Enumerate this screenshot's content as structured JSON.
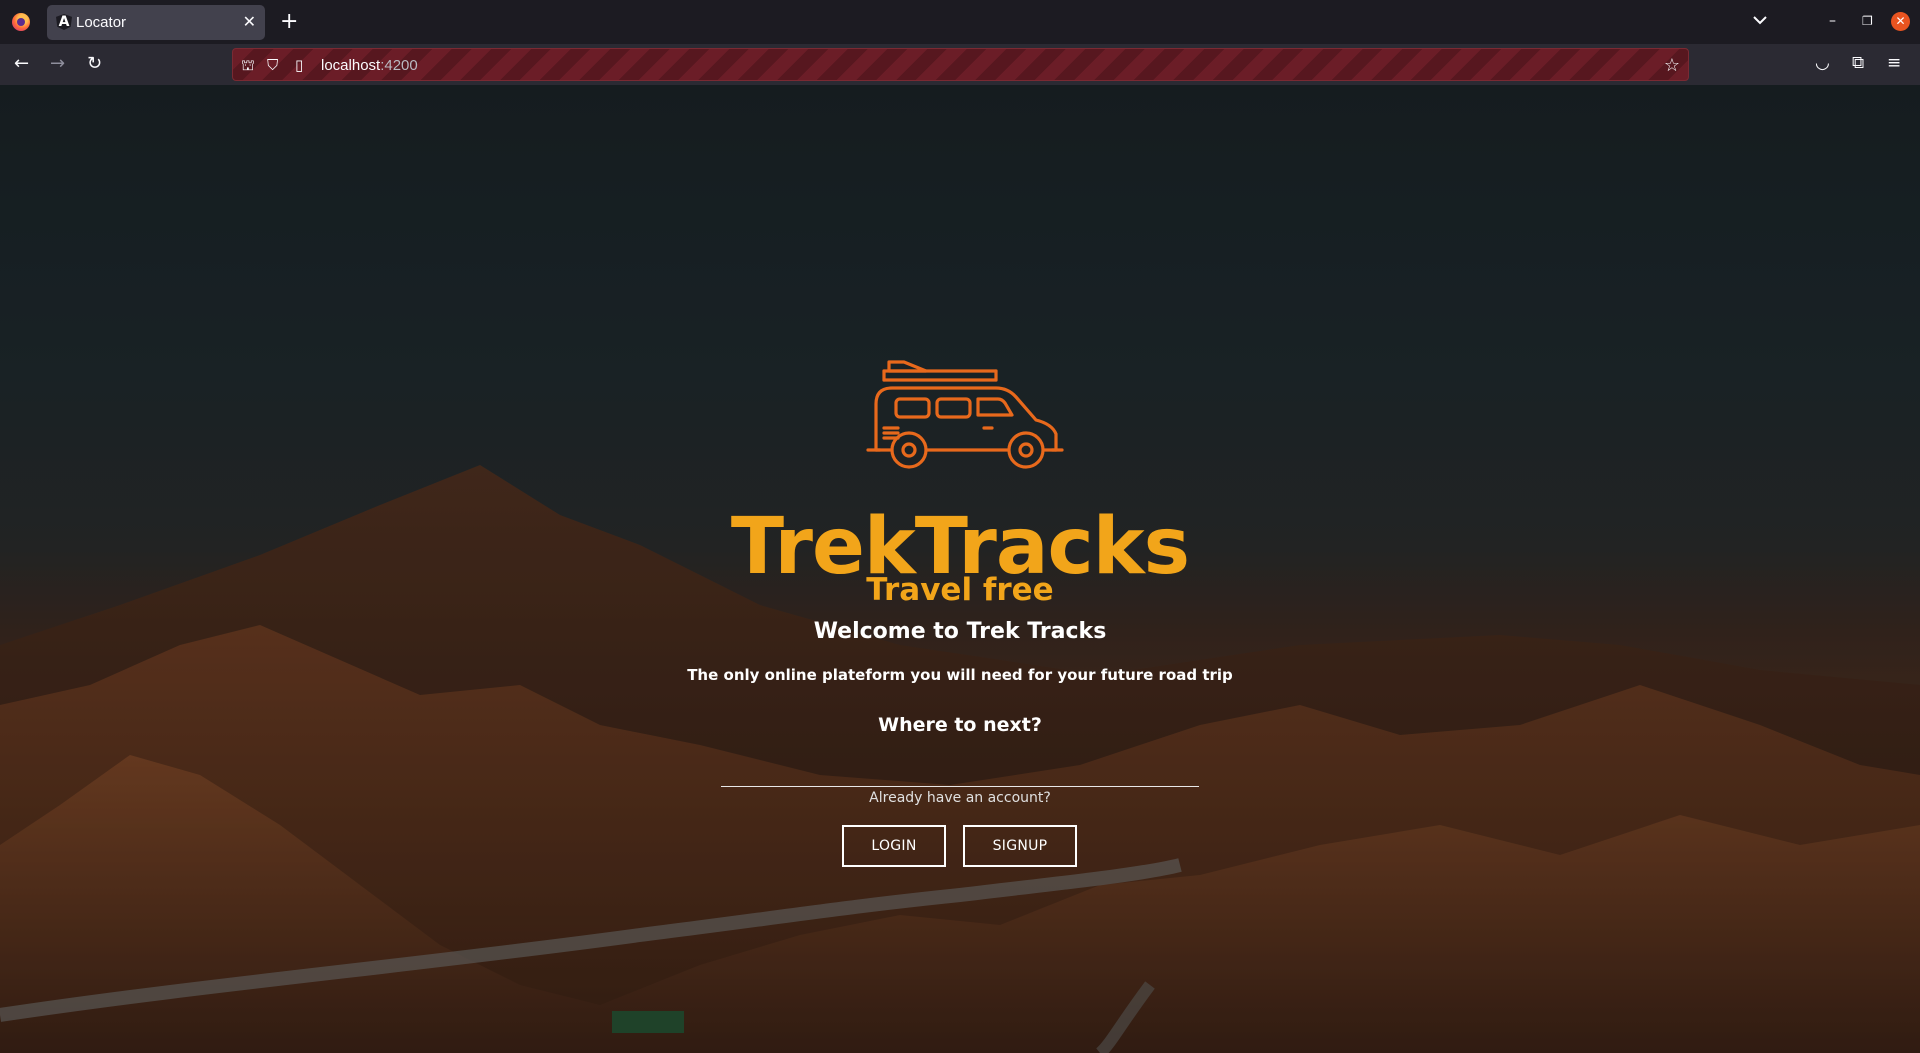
{
  "browser": {
    "tab_title": "Locator",
    "tab_favicon": "A",
    "url_host": "localhost",
    "url_port": ":4200"
  },
  "icons": {
    "firefox": "firefox-logo-icon",
    "tab_close": "close-icon",
    "new_tab": "plus-icon",
    "tab_list": "chevron-down-icon",
    "minimize": "minimize-icon",
    "restore": "restore-icon",
    "window_close": "close-icon",
    "back": "arrow-left-icon",
    "forward": "arrow-right-icon",
    "reload": "reload-icon",
    "tracking": "shield-icon",
    "page_info": "page-icon",
    "bookmark": "star-icon",
    "pocket": "pocket-icon",
    "extensions": "puzzle-icon",
    "menu": "hamburger-icon",
    "logo": "campervan-icon"
  },
  "colors": {
    "brand_orange": "#f2a51a",
    "logo_orange": "#e8691c",
    "url_stripe": "#6b1d27"
  },
  "hero": {
    "brand": "TrekTracks",
    "tagline": "Travel free",
    "welcome": "Welcome to Trek Tracks",
    "subtitle": "The only online plateform you will need for your future road trip",
    "question": "Where to next?",
    "destination_value": "",
    "account_prompt": "Already have an account?",
    "login_label": "LOGIN",
    "signup_label": "SIGNUP"
  }
}
